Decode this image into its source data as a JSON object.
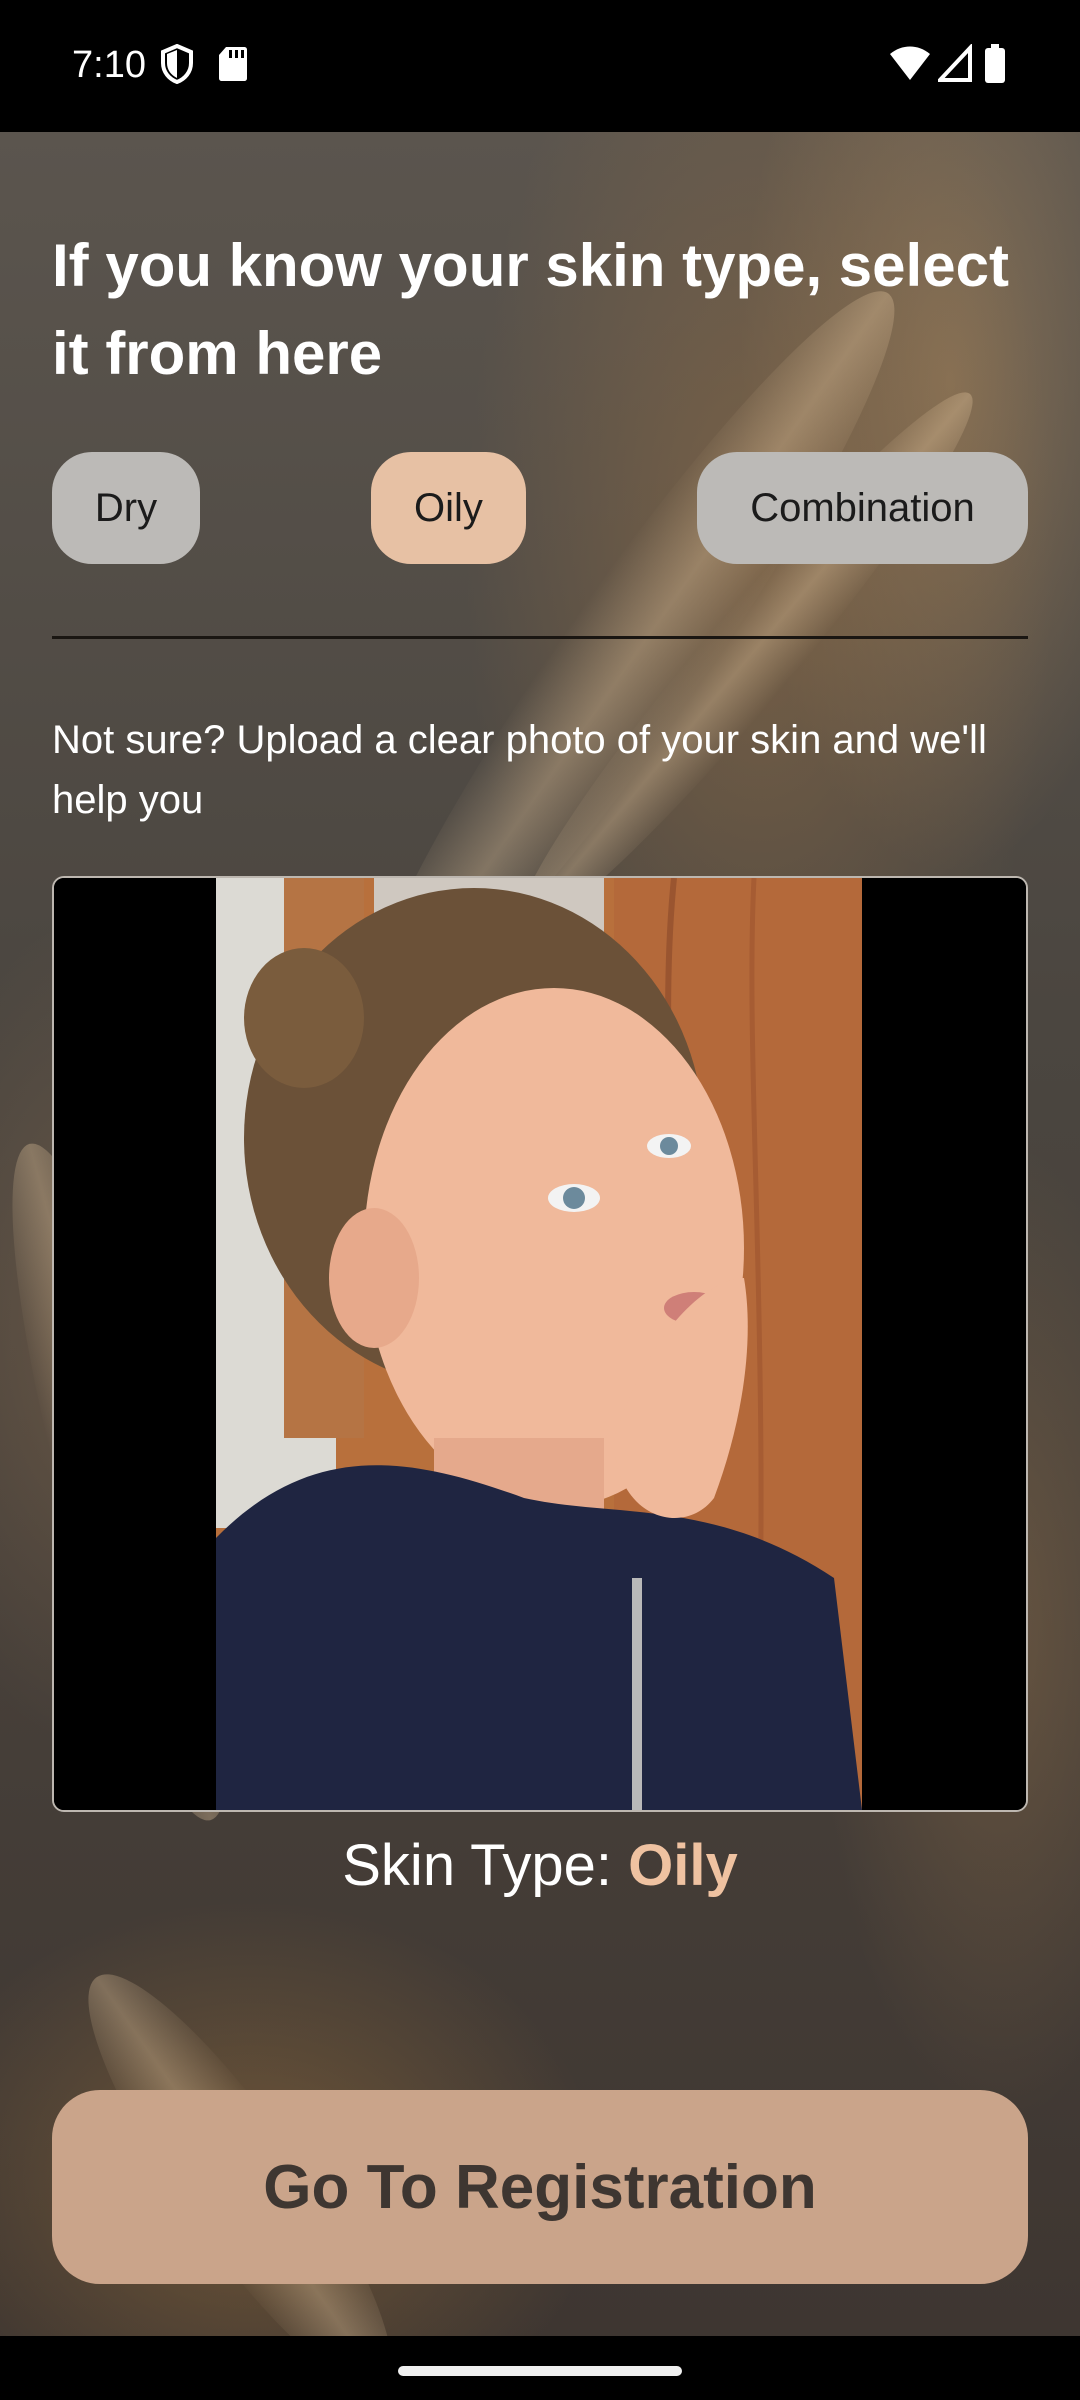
{
  "status_bar": {
    "time": "7:10",
    "left_icons": [
      "shield-icon",
      "sd-card-icon"
    ],
    "right_icons": [
      "wifi-icon",
      "signal-icon",
      "battery-icon"
    ]
  },
  "heading": "If you know your skin type, select it from here",
  "skin_type_options": [
    {
      "label": "Dry",
      "selected": false
    },
    {
      "label": "Oily",
      "selected": true
    },
    {
      "label": "Combination",
      "selected": false
    }
  ],
  "upload_hint": "Not sure? Upload a clear photo of your skin and we'll help you",
  "result": {
    "label": "Skin Type: ",
    "value": "Oily"
  },
  "cta_label": "Go To Registration",
  "colors": {
    "selected_chip": "#e7c1a4",
    "unselected_chip": "#bcbab7",
    "accent_text": "#efc2a1",
    "cta_background": "#caa48a"
  }
}
